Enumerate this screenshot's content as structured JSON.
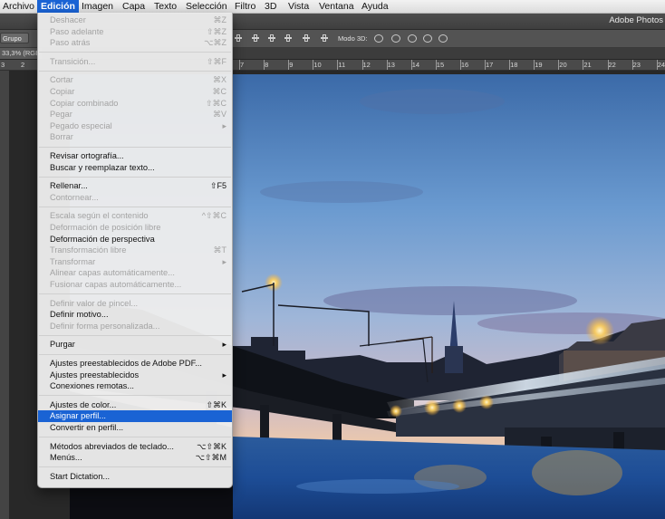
{
  "menubar": {
    "items": [
      "Archivo",
      "Edición",
      "Imagen",
      "Capa",
      "Texto",
      "Selección",
      "Filtro",
      "3D",
      "Vista",
      "Ventana",
      "Ayuda"
    ],
    "active_index": 1
  },
  "app": {
    "title": "Adobe Photos"
  },
  "optionsbar": {
    "layer_select": "Grupo",
    "mode3d_label": "Modo 3D:"
  },
  "document_tab": {
    "label": "33,3% (RGB"
  },
  "ruler": {
    "left_ticks": [
      "3",
      "2"
    ],
    "ticks": [
      "7",
      "8",
      "9",
      "10",
      "11",
      "12",
      "13",
      "14",
      "15",
      "16",
      "17",
      "18",
      "19",
      "20",
      "21",
      "22",
      "23",
      "24"
    ]
  },
  "edit_menu": {
    "groups": [
      [
        {
          "label": "Deshacer",
          "shortcut": "⌘Z",
          "enabled": false
        },
        {
          "label": "Paso adelante",
          "shortcut": "⇧⌘Z",
          "enabled": false
        },
        {
          "label": "Paso atrás",
          "shortcut": "⌥⌘Z",
          "enabled": false
        }
      ],
      [
        {
          "label": "Transición...",
          "shortcut": "⇧⌘F",
          "enabled": false
        }
      ],
      [
        {
          "label": "Cortar",
          "shortcut": "⌘X",
          "enabled": false
        },
        {
          "label": "Copiar",
          "shortcut": "⌘C",
          "enabled": false
        },
        {
          "label": "Copiar combinado",
          "shortcut": "⇧⌘C",
          "enabled": false
        },
        {
          "label": "Pegar",
          "shortcut": "⌘V",
          "enabled": false
        },
        {
          "label": "Pegado especial",
          "shortcut": "▸",
          "enabled": false
        },
        {
          "label": "Borrar",
          "shortcut": "",
          "enabled": false
        }
      ],
      [
        {
          "label": "Revisar ortografía...",
          "shortcut": "",
          "enabled": true
        },
        {
          "label": "Buscar y reemplazar texto...",
          "shortcut": "",
          "enabled": true
        }
      ],
      [
        {
          "label": "Rellenar...",
          "shortcut": "⇧F5",
          "enabled": true
        },
        {
          "label": "Contornear...",
          "shortcut": "",
          "enabled": false
        }
      ],
      [
        {
          "label": "Escala según el contenido",
          "shortcut": "^⇧⌘C",
          "enabled": false
        },
        {
          "label": "Deformación de posición libre",
          "shortcut": "",
          "enabled": false
        },
        {
          "label": "Deformación de perspectiva",
          "shortcut": "",
          "enabled": true
        },
        {
          "label": "Transformación libre",
          "shortcut": "⌘T",
          "enabled": false
        },
        {
          "label": "Transformar",
          "shortcut": "▸",
          "enabled": false
        },
        {
          "label": "Alinear capas automáticamente...",
          "shortcut": "",
          "enabled": false
        },
        {
          "label": "Fusionar capas automáticamente...",
          "shortcut": "",
          "enabled": false
        }
      ],
      [
        {
          "label": "Definir valor de pincel...",
          "shortcut": "",
          "enabled": false
        },
        {
          "label": "Definir motivo...",
          "shortcut": "",
          "enabled": true
        },
        {
          "label": "Definir forma personalizada...",
          "shortcut": "",
          "enabled": false
        }
      ],
      [
        {
          "label": "Purgar",
          "shortcut": "▸",
          "enabled": true
        }
      ],
      [
        {
          "label": "Ajustes preestablecidos de Adobe PDF...",
          "shortcut": "",
          "enabled": true
        },
        {
          "label": "Ajustes preestablecidos",
          "shortcut": "▸",
          "enabled": true
        },
        {
          "label": "Conexiones remotas...",
          "shortcut": "",
          "enabled": true
        }
      ],
      [
        {
          "label": "Ajustes de color...",
          "shortcut": "⇧⌘K",
          "enabled": true
        },
        {
          "label": "Asignar perfil...",
          "shortcut": "",
          "enabled": true,
          "highlighted": true
        },
        {
          "label": "Convertir en perfil...",
          "shortcut": "",
          "enabled": true
        }
      ],
      [
        {
          "label": "Métodos abreviados de teclado...",
          "shortcut": "⌥⇧⌘K",
          "enabled": true
        },
        {
          "label": "Menús...",
          "shortcut": "⌥⇧⌘M",
          "enabled": true
        }
      ],
      [
        {
          "label": "Start Dictation...",
          "shortcut": "",
          "enabled": true
        }
      ]
    ]
  }
}
